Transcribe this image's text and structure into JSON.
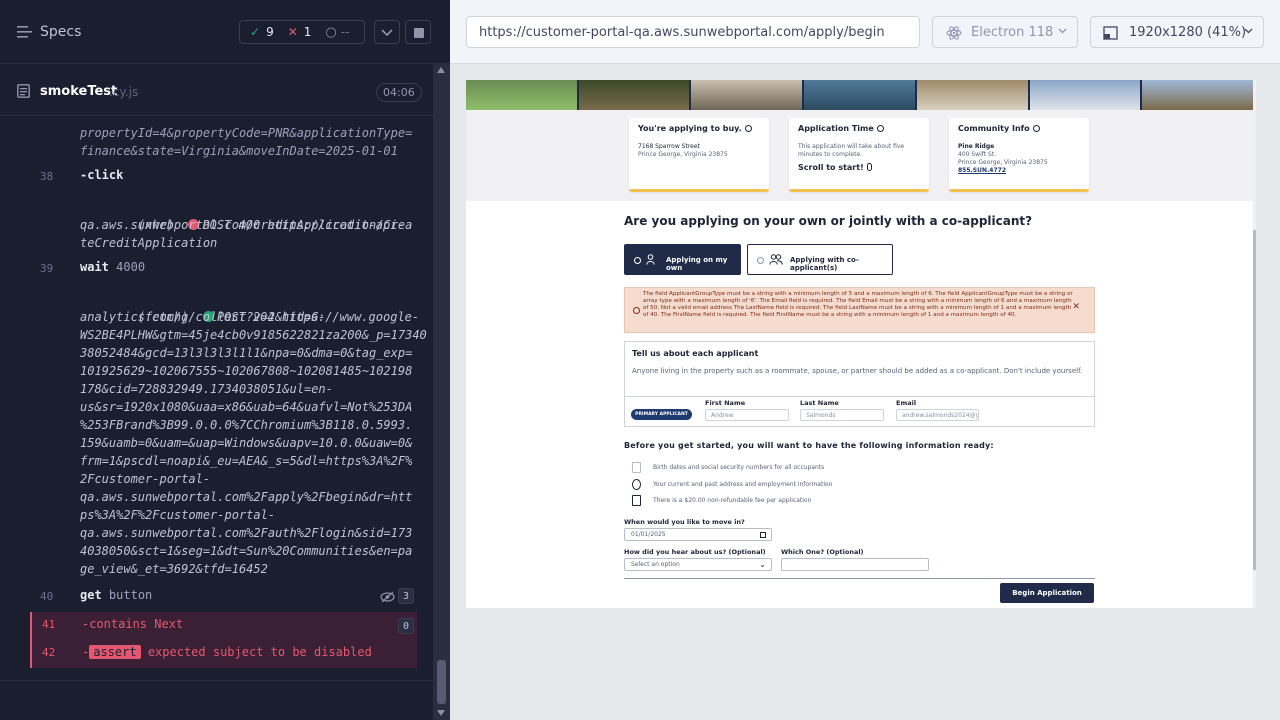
{
  "reporter": {
    "specs_label": "Specs",
    "stats": {
      "passed": "9",
      "failed": "1",
      "pending": "--"
    },
    "spec": {
      "name": "smokeTest",
      "ext": ".cy.js",
      "duration": "04:06"
    },
    "log": {
      "l1": "propertyId=4&propertyCode=PNR&applicationType=",
      "l2": "finance&state=Virginia&moveInDate=2025-01-01",
      "c38_num": "38",
      "c38_cmd": "-click",
      "xhr_type": "(xhr)",
      "xhr_text": "POST 400 https://credit-api-",
      "xhr_l2": "qa.aws.sunwebportal.com/creditApplication/Crea",
      "xhr_l3": "teCreditApplication",
      "c39_num": "39",
      "c39_cmd": "wait",
      "c39_arg": "4000",
      "fetch_type": "(fetch)",
      "fetch_text": "POST 204 https://www.google-",
      "fetch_lines": [
        "analytics.com/g/collect?v=2&tid=G-",
        "WS2BE4PLHW&gtm=45je4cb0v9185622821za200&_p=17340",
        "38052484&gcd=13l3l3l3l1l1&npa=0&dma=0&tag_exp=",
        "101925629~102067555~102067808~102081485~102198",
        "178&cid=728832949.1734038051&ul=en-",
        "us&sr=1920x1080&uaa=x86&uab=64&uafvl=Not%253DA",
        "%253FBrand%3B99.0.0.0%7CChromium%3B118.0.5993.",
        "159&uamb=0&uam=&uap=Windows&uapv=10.0.0&uaw=0&",
        "frm=1&pscdl=noapi&_eu=AEA&_s=5&dl=https%3A%2F%",
        "2Fcustomer-portal-",
        "qa.aws.sunwebportal.com%2Fapply%2Fbegin&dr=htt",
        "ps%3A%2F%2Fcustomer-portal-",
        "qa.aws.sunwebportal.com%2Fauth%2Flogin&sid=173",
        "4038050&sct=1&seg=1&dt=Sun%20Communities&en=pa",
        "ge_view&_et=3692&tfd=16452"
      ],
      "c40_num": "40",
      "c40_cmd": "get",
      "c40_arg": "button",
      "c40_count": "3",
      "c41_num": "41",
      "c41_cmd": "-contains",
      "c41_arg": "Next",
      "c41_count": "0",
      "c42_num": "42",
      "c42_badge": "assert",
      "c42_text": "expected subject to be disabled"
    }
  },
  "aut": {
    "url": "https://customer-portal-qa.aws.sunwebportal.com/apply/begin",
    "browser": "Electron 118",
    "viewport": "1920x1280  (41%)",
    "cards": {
      "buy_title": "You're applying to buy.",
      "buy_l1": "7168 Sparrow Street",
      "buy_l2": "Prince George, Virginia 23875",
      "time_title": "Application Time",
      "time_l1": "This application will take about five",
      "time_l2": "minutes to complete.",
      "time_scroll": "Scroll to start!",
      "comm_title": "Community Info",
      "comm_l1": "Pine Ridge",
      "comm_l2": "400 Swift St.",
      "comm_l3": "Prince George, Virginia 23875",
      "comm_phone": "855.SUN.4772"
    },
    "question": "Are you applying on your own or jointly with a co-applicant?",
    "opt_own": "Applying on my own",
    "opt_joint": "Applying with co-applicant(s)",
    "error": "The field ApplicantGroupType must be a string with a minimum length of 5 and a maximum length of 6. The field ApplicantGroupType must be a string or array type with a maximum length of '6'. The Email field is required. The field Email must be a string with a minimum length of 6 and a maximum length of 50. Not a valid email address The LastName field is required. The field LastName must be a string with a minimum length of 1 and a maximum length of 40. The FirstName field is required. The field FirstName must be a string with a minimum length of 1 and a maximum length of 40.",
    "applicant": {
      "title": "Tell us about each applicant",
      "desc": "Anyone living in the property such as a roommate, spouse, or partner should be added as a co-applicant. Don't include yourself.",
      "badge": "PRIMARY APPLICANT",
      "first_label": "First Name",
      "last_label": "Last Name",
      "email_label": "Email",
      "first_value": "Andrew",
      "last_value": "Salmonds",
      "email_value": "andrew.salmonds2024@g"
    },
    "before_title": "Before you get started, you will want to have the following information ready:",
    "req": [
      "Birth dates and social security numbers for all occupants",
      "Your current and past address and employment information",
      "There is a $20.00 non-refundable fee per application"
    ],
    "move_label": "When would you like to move in?",
    "move_value": "01/01/2025",
    "hear_label": "How did you hear about us? (Optional)",
    "hear_value": "Select an option",
    "which_label": "Which One? (Optional)",
    "begin": "Begin Application"
  }
}
